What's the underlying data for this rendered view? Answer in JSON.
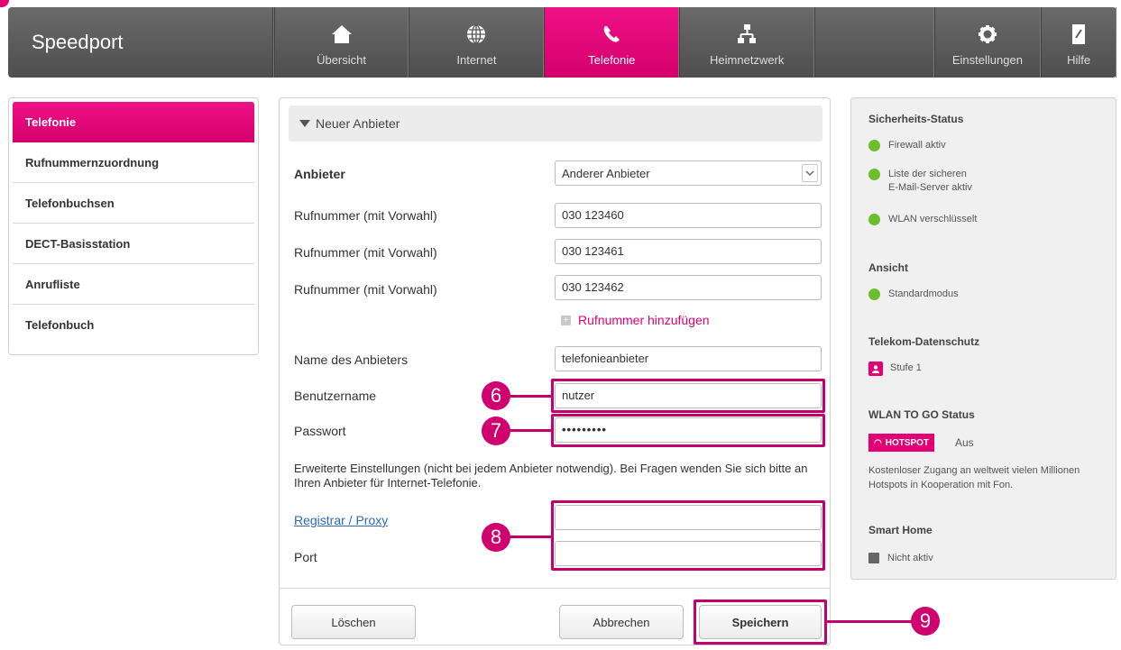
{
  "nav": {
    "brand": "Speedport",
    "items": [
      {
        "label": "Übersicht"
      },
      {
        "label": "Internet"
      },
      {
        "label": "Telefonie"
      },
      {
        "label": "Heimnetzwerk"
      },
      {
        "label": "Einstellungen"
      },
      {
        "label": "Hilfe"
      }
    ]
  },
  "sidebar": {
    "items": [
      {
        "label": "Telefonie"
      },
      {
        "label": "Rufnummernzuordnung"
      },
      {
        "label": "Telefonbuchsen"
      },
      {
        "label": "DECT-Basisstation"
      },
      {
        "label": "Anrufliste"
      },
      {
        "label": "Telefonbuch"
      }
    ]
  },
  "form": {
    "section_title": "Neuer Anbieter",
    "provider_label": "Anbieter",
    "provider_value": "Anderer Anbieter",
    "number_label": "Rufnummer (mit Vorwahl)",
    "numbers": [
      "030 123460",
      "030 123461",
      "030 123462"
    ],
    "add_number": "Rufnummer hinzufügen",
    "name_label": "Name des Anbieters",
    "name_value": "telefonieanbieter",
    "user_label": "Benutzername",
    "user_value": "nutzer",
    "password_label": "Passwort",
    "password_value": "•••••••••",
    "info_text": "Erweiterte Einstellungen (nicht bei jedem Anbieter notwendig). Bei Fragen wenden Sie sich bitte an Ihren Anbieter für Internet-Telefonie.",
    "registrar_label": "Registrar / Proxy",
    "registrar_value": "",
    "port_label": "Port",
    "port_value": "",
    "delete_button": "Löschen",
    "cancel_button": "Abbrechen",
    "save_button": "Speichern"
  },
  "callouts": [
    "6",
    "7",
    "8",
    "9"
  ],
  "status": {
    "security_title": "Sicherheits-Status",
    "firewall": "Firewall aktiv",
    "mail_line1": "Liste der sicheren",
    "mail_line2": "E-Mail-Server aktiv",
    "wlan": "WLAN verschlüsselt",
    "view_title": "Ansicht",
    "view_mode": "Standardmodus",
    "privacy_title": "Telekom-Datenschutz",
    "privacy_level": "Stufe 1",
    "wlan_to_go_title": "WLAN TO GO Status",
    "hotspot_badge": "HOTSPOT",
    "hotspot_state": "Aus",
    "hotspot_desc": "Kostenloser Zugang an weltweit vielen Millionen Hotspots in Kooperation mit Fon.",
    "smarthome_title": "Smart Home",
    "smarthome_state": "Nicht aktiv"
  },
  "colors": {
    "accent": "#e20074",
    "nav_bg": "#5a5a5a",
    "status_ok": "#6cbf2c",
    "link": "#2a6ab8"
  }
}
